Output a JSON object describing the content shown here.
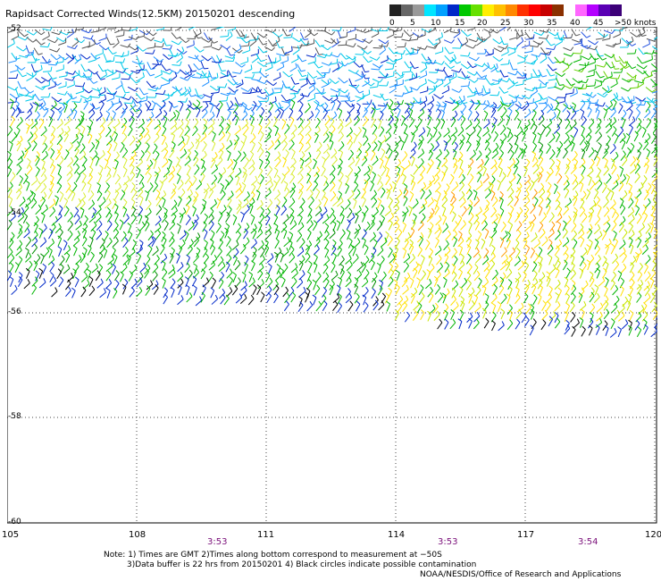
{
  "title": "Rapidsact Corrected Winds(12.5KM) 20150201 descending",
  "legend": {
    "colors": [
      "#222222",
      "#666666",
      "#999999",
      "#00e5ff",
      "#00a0ff",
      "#0028c8",
      "#00c800",
      "#66e000",
      "#ffee00",
      "#ffc000",
      "#ff8800",
      "#ff3000",
      "#ff0000",
      "#c80000",
      "#8a3000",
      "#ffffff",
      "#ff66ff",
      "#b400ff",
      "#5a00b4",
      "#3c0078"
    ],
    "labels": [
      "0",
      "5",
      "10",
      "15",
      "20",
      "25",
      "30",
      "35",
      "40",
      "45",
      ">50 knots"
    ]
  },
  "lat_labels": [
    "-52",
    "-54",
    "-56",
    "-58",
    "-60"
  ],
  "lon_labels": [
    "105",
    "108",
    "111",
    "114",
    "117",
    "120"
  ],
  "time_labels": [
    "3:53",
    "3:53",
    "3:54"
  ],
  "notes": [
    "Note: 1) Times are GMT 2)Times along bottom correspond to measurement at −50S",
    "3)Data buffer is 22 hrs from 20150201 4) Black circles indicate possible contamination",
    "NOAA/NESDIS/Office of Research and Applications"
  ],
  "colors": {
    "grid": "#444444",
    "calm": "#00c8e8",
    "mid_blue": "#0028c8",
    "green": "#00b400",
    "yellow": "#ffe000",
    "orange": "#ff9a00",
    "black": "#000000",
    "time": "#7a0f7a"
  }
}
